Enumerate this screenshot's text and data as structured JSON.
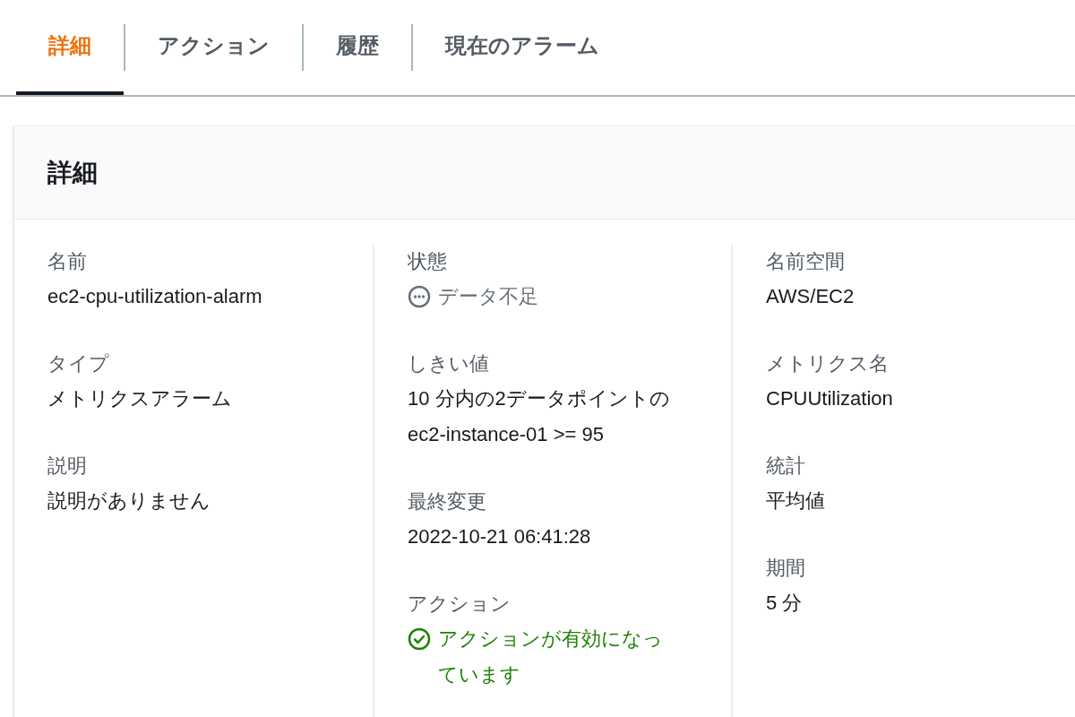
{
  "tabs": [
    {
      "label": "詳細",
      "selected": true
    },
    {
      "label": "アクション",
      "selected": false
    },
    {
      "label": "履歴",
      "selected": false
    },
    {
      "label": "現在のアラーム",
      "selected": false
    }
  ],
  "panel": {
    "title": "詳細",
    "columns": [
      {
        "items": [
          {
            "label": "名前",
            "kind": "plain",
            "lines": [
              "ec2-cpu-utilization-alarm"
            ]
          },
          {
            "label": "タイプ",
            "kind": "plain",
            "lines": [
              "メトリクスアラーム"
            ]
          },
          {
            "label": "説明",
            "kind": "plain",
            "lines": [
              "説明がありません"
            ]
          }
        ]
      },
      {
        "items": [
          {
            "label": "状態",
            "kind": "insufficient",
            "lines": [
              "データ不足"
            ]
          },
          {
            "label": "しきい値",
            "kind": "plain",
            "lines": [
              "10 分内の2データポイントの",
              "ec2-instance-01 >= 95"
            ]
          },
          {
            "label": "最終変更",
            "kind": "plain",
            "lines": [
              "2022-10-21 06:41:28"
            ]
          },
          {
            "label": "アクション",
            "kind": "ok",
            "lines": [
              "アクションが有効になっ",
              "ています"
            ]
          }
        ]
      },
      {
        "items": [
          {
            "label": "名前空間",
            "kind": "plain",
            "lines": [
              "AWS/EC2"
            ]
          },
          {
            "label": "メトリクス名",
            "kind": "plain",
            "lines": [
              "CPUUtilization"
            ]
          },
          {
            "label": "統計",
            "kind": "plain",
            "lines": [
              "平均値"
            ]
          },
          {
            "label": "期間",
            "kind": "plain",
            "lines": [
              "5 分"
            ]
          }
        ]
      }
    ]
  }
}
